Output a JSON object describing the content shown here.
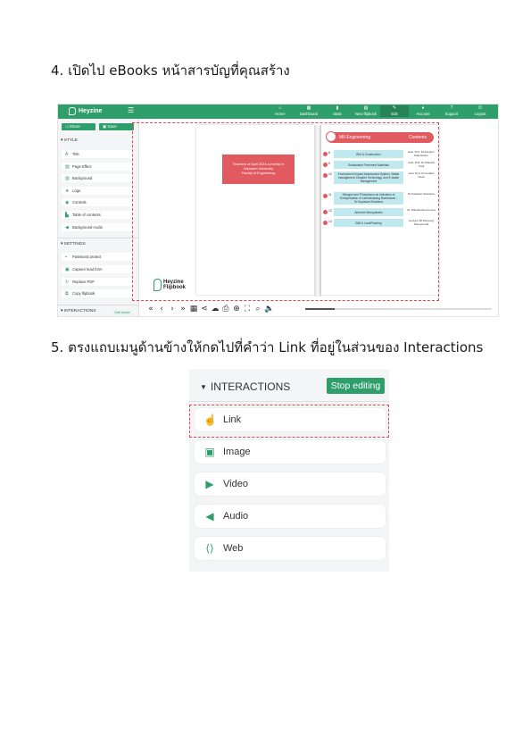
{
  "steps": {
    "step4": "4. เปิดไป eBooks หน้าสารบัญที่คุณสร้าง",
    "step5": "5. ตรงแถบเมนูด้านข้างให้กดไปที่คำว่า Link ที่อยู่ในส่วนของ Interactions"
  },
  "app": {
    "brand": "Heyzine",
    "nav": [
      {
        "label": "Home",
        "icon": "home-icon"
      },
      {
        "label": "Dashboard",
        "icon": "grid-icon"
      },
      {
        "label": "Stats",
        "icon": "stats-icon"
      },
      {
        "label": "New flipbook",
        "icon": "file-icon"
      },
      {
        "label": "Edit",
        "icon": "edit-icon"
      },
      {
        "label": "Account",
        "icon": "user-icon"
      },
      {
        "label": "Support",
        "icon": "question-icon"
      },
      {
        "label": "Logout",
        "icon": "power-icon"
      }
    ],
    "share_label": "Share",
    "save_label": "Save",
    "style_head": "STYLE",
    "style_items": [
      "Title",
      "Page Effect",
      "Background",
      "Logo",
      "Controls",
      "Table of contents",
      "Background Audio"
    ],
    "settings_head": "SETTINGS",
    "settings_items": [
      "Password protect",
      "Capture lead form",
      "Replace PDF",
      "Copy flipbook"
    ],
    "interactions_head": "INTERACTIONS",
    "edit_mode_label": "Edit mode"
  },
  "book": {
    "cover_text": [
      "Teachers of April 2024-currently in",
      "Harunam University",
      "Faculty of Engineering"
    ],
    "toc_label": "MII Engineering",
    "toc_title": "Contents",
    "toc": [
      {
        "num": "8",
        "title": "BIM & Construction",
        "author": "Asst. Prof. Dr.Kamjorn Sukpornkun"
      },
      {
        "num": "9",
        "title": "Sustainable Pavement Materials",
        "author": "Asst. Prof. Dr.Khansid Yusit"
      },
      {
        "num": "10",
        "title": "Environment Impact Assessment System, Waste management, Disaster Technology, and E-waste Management",
        "author": "Asst. Prof. Dr.Vorakul Nook"
      },
      {
        "num": "11",
        "title": "Nitrogen and Phosphorus as Indicators of Eutrophication of Laemchabang Businesses - Dr.Supawan Srisetana",
        "author": "Dr.Supawan Srisetana"
      },
      {
        "num": "12",
        "title": "Airborne Microplastics",
        "author": "Dr. Wai Ahmanmnmong"
      },
      {
        "num": "13",
        "title": "BIM & LandPlanning",
        "author": "Lecturer Mr.Penpong Kanepornrat"
      }
    ],
    "footer_brand_1": "Heyzine",
    "footer_brand_2": "Flipbook",
    "controls": [
      "«",
      "‹",
      "›",
      "»",
      "▦",
      "⋖",
      "☁",
      "⎙",
      "⊕",
      "⛶",
      "⌕",
      "🔈"
    ],
    "progress": 0.16
  },
  "interactions_panel": {
    "header": "INTERACTIONS",
    "stop_label": "Stop editing",
    "items": [
      {
        "label": "Link",
        "icon": "pointer-hand-icon"
      },
      {
        "label": "Image",
        "icon": "image-icon"
      },
      {
        "label": "Video",
        "icon": "play-icon"
      },
      {
        "label": "Audio",
        "icon": "speaker-icon"
      },
      {
        "label": "Web",
        "icon": "web-code-icon"
      }
    ]
  },
  "colors": {
    "brand_green": "#2e9e6a",
    "highlight_red": "#e04848",
    "toc_red": "#e05a5f",
    "toc_cyan": "#bfe9ee"
  }
}
